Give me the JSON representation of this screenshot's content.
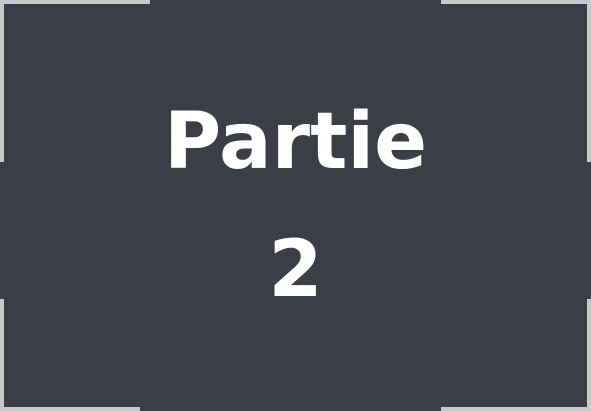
{
  "slide": {
    "title_line1": "Partie",
    "title_line2": "2",
    "background_color": "#3b3e46",
    "text_color": "#ffffff",
    "frame_color": "#c9c9c9"
  }
}
